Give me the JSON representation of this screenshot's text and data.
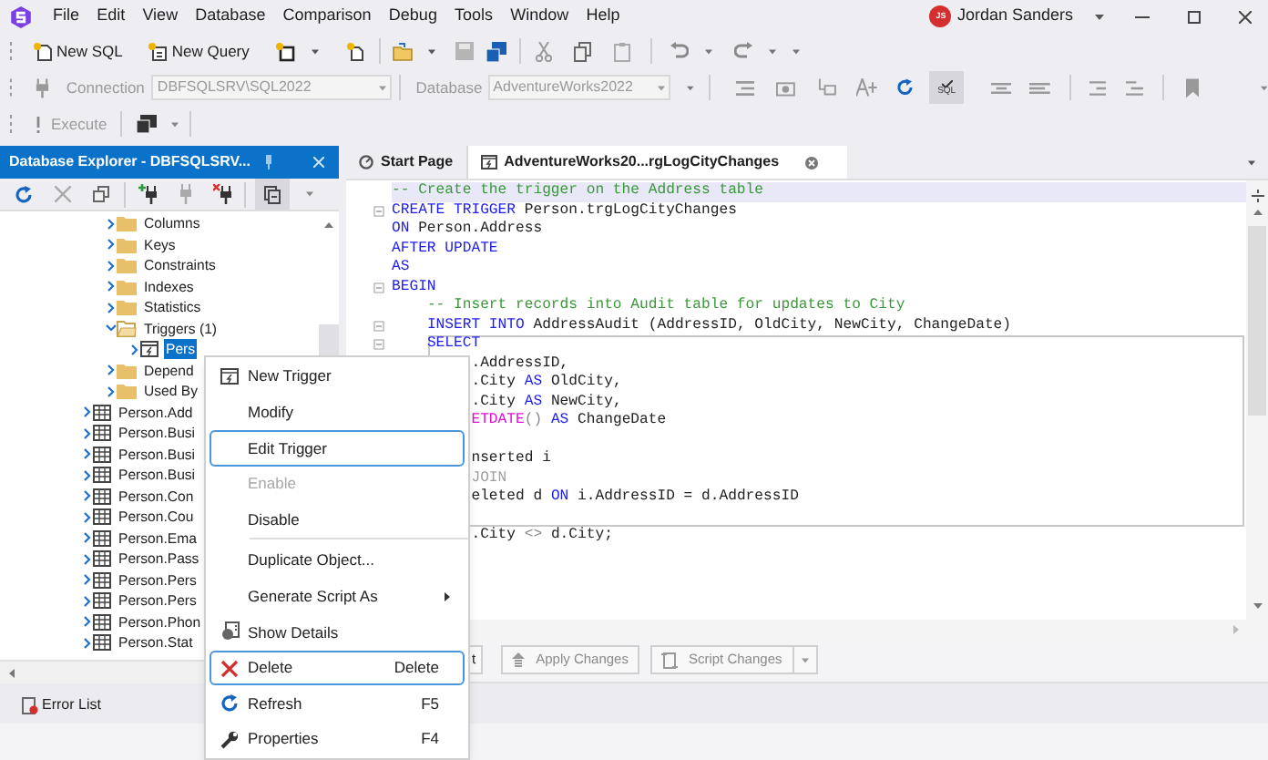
{
  "menu_bar": {
    "items": [
      "File",
      "Edit",
      "View",
      "Database",
      "Comparison",
      "Debug",
      "Tools",
      "Window",
      "Help"
    ]
  },
  "user": {
    "initials": "JS",
    "name": "Jordan Sanders"
  },
  "toolbar": {
    "buttons": [
      {
        "label": "New SQL"
      },
      {
        "label": "New Query"
      }
    ]
  },
  "connection_bar": {
    "connection_label": "Connection",
    "connection": "DBFSQLSRV\\SQL2022",
    "database_label": "Database",
    "database": "AdventureWorks2022",
    "disabled": true,
    "sql_toggle": {
      "label": "SQL",
      "pressed": true
    }
  },
  "execute_bar": {
    "label": "Execute",
    "disabled": true
  },
  "explorer": {
    "title": "Database Explorer - DBFSQLSRV...",
    "tree": [
      {
        "children": [
          {
            "label": "Columns",
            "kind": "folder",
            "expanded": false,
            "selected": false
          },
          {
            "label": "Keys",
            "kind": "folder",
            "expanded": false,
            "selected": false
          },
          {
            "label": "Constraints",
            "kind": "folder",
            "expanded": false,
            "selected": false
          },
          {
            "label": "Indexes",
            "kind": "folder",
            "expanded": false,
            "selected": false
          },
          {
            "label": "Statistics",
            "kind": "folder",
            "expanded": false,
            "selected": false
          },
          {
            "label": "Triggers (1)",
            "kind": "folder",
            "expanded": true,
            "selected": false,
            "children": [
              {
                "label": "Pers",
                "kind": "trigger",
                "expanded": false,
                "selected": true
              }
            ]
          },
          {
            "label": "Depend",
            "kind": "folder",
            "expanded": false,
            "selected": false
          },
          {
            "label": "Used By",
            "kind": "folder",
            "expanded": false,
            "selected": false
          }
        ]
      },
      {
        "label": "Person.Add",
        "kind": "table",
        "expanded": false,
        "selected": false
      },
      {
        "label": "Person.Busi",
        "kind": "table",
        "expanded": false,
        "selected": false
      },
      {
        "label": "Person.Busi",
        "kind": "table",
        "expanded": false,
        "selected": false
      },
      {
        "label": "Person.Busi",
        "kind": "table",
        "expanded": false,
        "selected": false
      },
      {
        "label": "Person.Con",
        "kind": "table",
        "expanded": false,
        "selected": false
      },
      {
        "label": "Person.Cou",
        "kind": "table",
        "expanded": false,
        "selected": false
      },
      {
        "label": "Person.Ema",
        "kind": "table",
        "expanded": false,
        "selected": false
      },
      {
        "label": "Person.Pass",
        "kind": "table",
        "expanded": false,
        "selected": false
      },
      {
        "label": "Person.Pers",
        "kind": "table",
        "expanded": false,
        "selected": false
      },
      {
        "label": "Person.Pers",
        "kind": "table",
        "expanded": false,
        "selected": false
      },
      {
        "label": "Person.Phon",
        "kind": "table",
        "expanded": false,
        "selected": false
      },
      {
        "label": "Person.Stat",
        "kind": "table",
        "expanded": false,
        "selected": false
      }
    ]
  },
  "tabs": [
    {
      "label": "Start Page",
      "selected": false
    },
    {
      "label": "AdventureWorks20...rgLogCityChanges",
      "selected": true
    }
  ],
  "editor": {
    "lines": [
      {
        "current": true,
        "fold": false,
        "block": false,
        "tokens": [
          {
            "text": "-- Create the trigger on the Address table",
            "kind": "comment"
          }
        ]
      },
      {
        "current": false,
        "fold": true,
        "block": false,
        "tokens": [
          {
            "text": "CREATE TRIGGER",
            "kind": "keyword"
          },
          {
            "text": " Person.trgLogCityChanges",
            "kind": "text"
          }
        ]
      },
      {
        "current": false,
        "fold": false,
        "block": false,
        "tokens": [
          {
            "text": "ON",
            "kind": "keyword"
          },
          {
            "text": " Person.Address",
            "kind": "text"
          }
        ]
      },
      {
        "current": false,
        "fold": false,
        "block": false,
        "tokens": [
          {
            "text": "AFTER UPDATE",
            "kind": "keyword"
          }
        ]
      },
      {
        "current": false,
        "fold": false,
        "block": false,
        "tokens": [
          {
            "text": "AS",
            "kind": "keyword"
          }
        ]
      },
      {
        "current": false,
        "fold": true,
        "block": false,
        "tokens": [
          {
            "text": "BEGIN",
            "kind": "keyword"
          }
        ]
      },
      {
        "current": false,
        "fold": false,
        "block": false,
        "tokens": [
          {
            "text": "    -- Insert records into Audit table for updates to City",
            "kind": "comment"
          }
        ]
      },
      {
        "current": false,
        "fold": true,
        "block": false,
        "tokens": [
          {
            "text": "    INSERT INTO",
            "kind": "keyword"
          },
          {
            "text": " AddressAudit (AddressID, OldCity, NewCity, ChangeDate)",
            "kind": "text"
          }
        ]
      },
      {
        "current": false,
        "fold": true,
        "block": true,
        "tokens": [
          {
            "text": "    SELECT",
            "kind": "keyword"
          }
        ]
      },
      {
        "current": false,
        "block": true,
        "tokens": [
          {
            "text": "         .AddressID,",
            "kind": "text"
          }
        ]
      },
      {
        "current": false,
        "block": true,
        "tokens": [
          {
            "text": "         .City ",
            "kind": "text"
          },
          {
            "text": "AS",
            "kind": "keyword"
          },
          {
            "text": " OldCity,",
            "kind": "text"
          }
        ]
      },
      {
        "current": false,
        "block": true,
        "tokens": [
          {
            "text": "         .City ",
            "kind": "text"
          },
          {
            "text": "AS",
            "kind": "keyword"
          },
          {
            "text": " NewCity,",
            "kind": "text"
          }
        ]
      },
      {
        "current": false,
        "block": true,
        "tokens": [
          {
            "text": "         ETDATE",
            "kind": "function"
          },
          {
            "text": "()",
            "kind": "punct"
          },
          {
            "text": " AS",
            "kind": "keyword"
          },
          {
            "text": " ChangeDate",
            "kind": "text"
          }
        ]
      },
      {
        "current": false,
        "block": true
      },
      {
        "current": false,
        "block": true,
        "tokens": [
          {
            "text": "         nserted i",
            "kind": "text"
          }
        ]
      },
      {
        "current": false,
        "block": true,
        "tokens": [
          {
            "text": "         JOIN",
            "kind": "dim"
          }
        ]
      },
      {
        "current": false,
        "block": true,
        "tokens": [
          {
            "text": "         eleted d ",
            "kind": "text"
          },
          {
            "text": "ON",
            "kind": "keyword"
          },
          {
            "text": " i.AddressID = d.AddressID",
            "kind": "text"
          }
        ]
      },
      {
        "current": false,
        "block": true
      },
      {
        "current": false,
        "block": false,
        "tokens": [
          {
            "text": "         .City ",
            "kind": "text"
          },
          {
            "text": "<>",
            "kind": "punct"
          },
          {
            "text": " d.City;",
            "kind": "text"
          }
        ]
      }
    ]
  },
  "editor_buttons": [
    {
      "label": "t",
      "kind": "plain",
      "disabled": false
    },
    {
      "label": "Apply Changes",
      "kind": "apply",
      "disabled": true
    },
    {
      "label": "Script Changes",
      "kind": "split",
      "disabled": true
    }
  ],
  "bottom_panel": {
    "tabs": [
      {
        "label": "Error List"
      }
    ]
  },
  "context_menu": {
    "items": [
      {
        "label": "New Trigger",
        "kind": "new",
        "selected": false,
        "disabled": false
      },
      {
        "label": "Modify",
        "kind": "plain",
        "selected": false,
        "disabled": false
      },
      {
        "label": "Edit Trigger",
        "kind": "plain",
        "selected": true,
        "disabled": false
      },
      {
        "label": "Enable",
        "kind": "plain",
        "selected": false,
        "disabled": true
      },
      {
        "label": "Disable",
        "kind": "plain",
        "selected": false,
        "disabled": false
      },
      {
        "kind": "separator"
      },
      {
        "label": "Duplicate Object...",
        "kind": "plain",
        "selected": false,
        "disabled": false
      },
      {
        "label": "Generate Script As",
        "kind": "submenu",
        "selected": false,
        "disabled": false
      },
      {
        "label": "Show Details",
        "kind": "details",
        "selected": false,
        "disabled": false
      },
      {
        "label": "Delete",
        "kind": "delete",
        "shortcut": "Delete",
        "selected": true,
        "disabled": false
      },
      {
        "label": "Refresh",
        "kind": "refresh",
        "shortcut": "F5",
        "selected": false,
        "disabled": false
      },
      {
        "label": "Properties",
        "kind": "properties",
        "shortcut": "F4",
        "selected": false,
        "disabled": false
      }
    ]
  }
}
